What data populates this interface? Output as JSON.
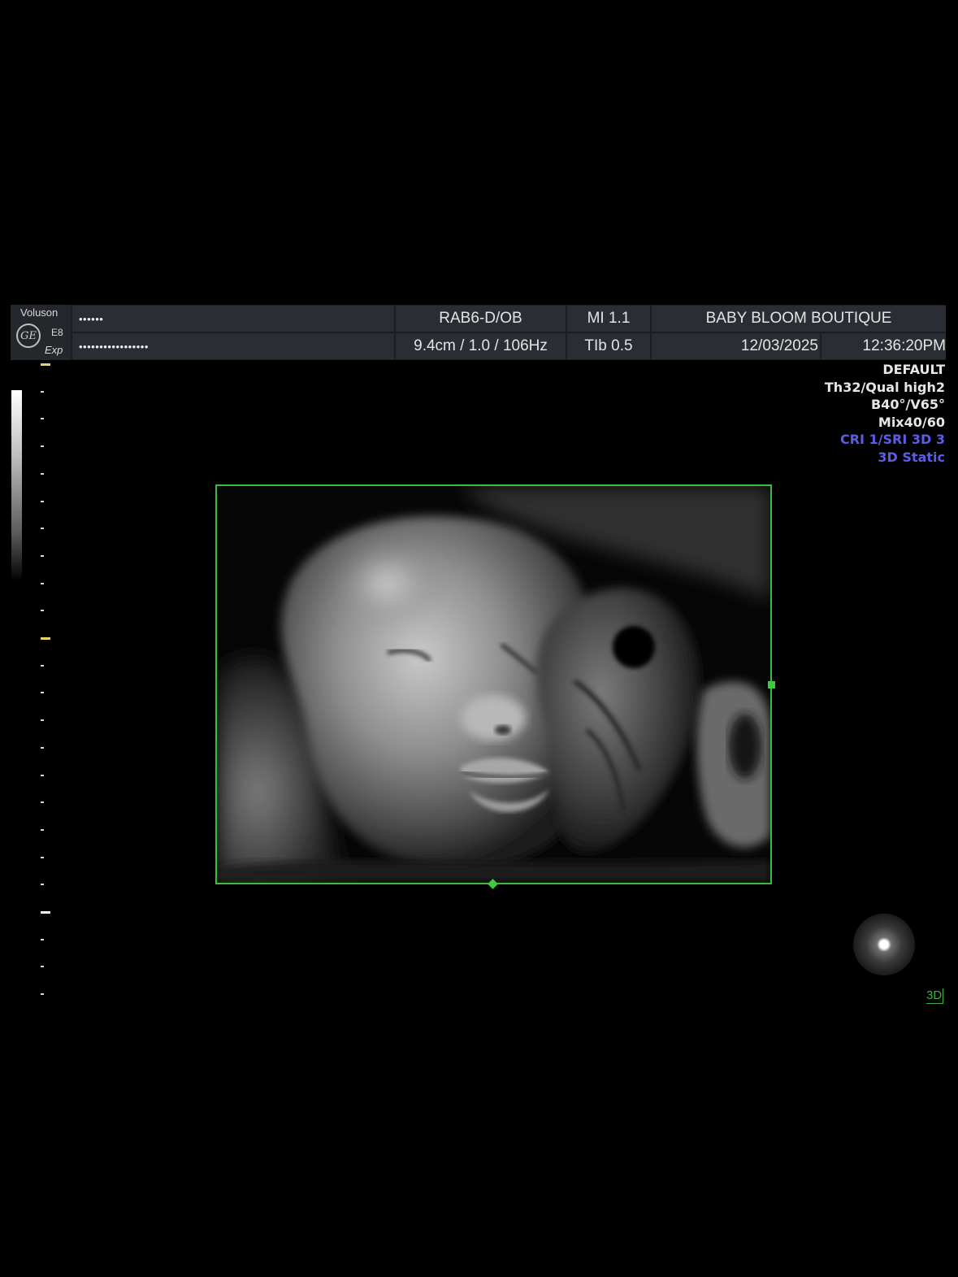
{
  "header": {
    "brand": "Voluson",
    "logo_mark": "GE",
    "model": "E8",
    "edition": "Exp",
    "patient_id_masked": "••••••",
    "patient_name_masked": "•••••••••••••••••",
    "probe_preset": "RAB6-D/OB",
    "depth_freq": "9.4cm / 1.0 / 106Hz",
    "mi": "MI  1.1",
    "tib": "TIb  0.5",
    "clinic": "BABY BLOOM BOUTIQUE",
    "date": "12/03/2025",
    "time": "12:36:20PM"
  },
  "settings": {
    "preset": "DEFAULT",
    "quality": "Th32/Qual high2",
    "angles": "B40°/V65°",
    "mix": "Mix40/60",
    "cri": "CRI 1/SRI 3D 3",
    "mode": "3D Static"
  },
  "mode_label": "3D",
  "colors": {
    "background": "#000000",
    "header_cell": "#2a2d33",
    "volume_frame": "#3dbb3d",
    "info_text": "#e6e6e6",
    "info_highlight": "#5c5ce8"
  },
  "icons": {
    "logo": "ge-monogram-icon",
    "light_source": "light-source-sphere-icon"
  }
}
